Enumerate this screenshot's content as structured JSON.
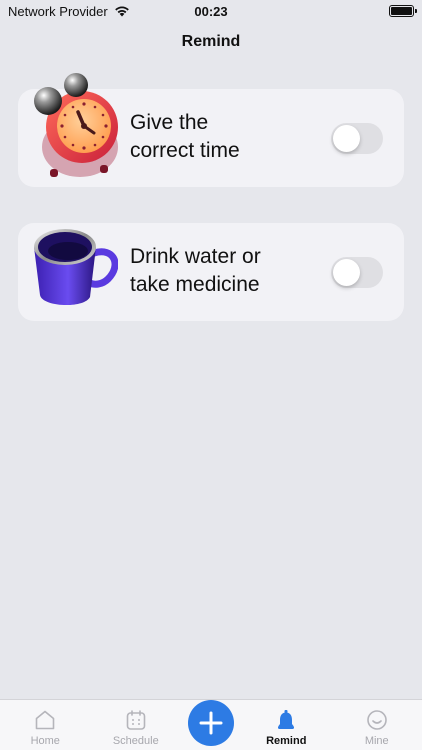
{
  "status_bar": {
    "carrier": "Network Provider",
    "time": "00:23"
  },
  "header": {
    "title": "Remind"
  },
  "reminders": [
    {
      "label": "Give the\ncorrect time",
      "icon": "alarm-clock-icon",
      "enabled": false
    },
    {
      "label": "Drink water or\ntake medicine",
      "icon": "mug-icon",
      "enabled": false
    }
  ],
  "tab_bar": {
    "items": [
      {
        "label": "Home",
        "icon": "home-icon",
        "active": false
      },
      {
        "label": "Schedule",
        "icon": "calendar-icon",
        "active": false
      },
      {
        "label": "Remind",
        "icon": "bell-icon",
        "active": true
      },
      {
        "label": "Mine",
        "icon": "smiley-icon",
        "active": false
      }
    ],
    "center_button": {
      "icon": "plus-icon"
    }
  },
  "colors": {
    "accent": "#2d7be4",
    "background": "#e6e7ec",
    "card": "#f2f2f6",
    "inactive_tab": "#a7a7ad"
  }
}
